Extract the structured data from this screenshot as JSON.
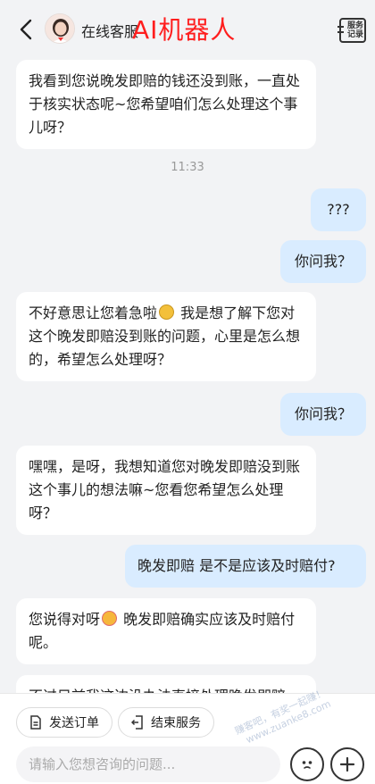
{
  "header": {
    "title": "在线客服",
    "overlay_text": "AI机器人",
    "service_record_label": "服务记录"
  },
  "messages": [
    {
      "side": "left",
      "text": "我看到您说晚发即赔的钱还没到账，一直处于核实状态呢~您希望咱们怎么处理这个事儿呀？"
    },
    {
      "side": "time",
      "text": "11:33"
    },
    {
      "side": "right",
      "text": "???"
    },
    {
      "side": "right",
      "text": "你问我？"
    },
    {
      "side": "left",
      "text_before": "不好意思让您着急啦",
      "text_after": " 我是想了解下您对这个晚发即赔没到账的问题，心里是怎么想的，希望怎么处理呀？"
    },
    {
      "side": "right",
      "text": "你问我？"
    },
    {
      "side": "left",
      "text": "嘿嘿，是呀，我想知道您对晚发即赔没到账这个事儿的想法嘛~您看您希望怎么处理呀？"
    },
    {
      "side": "right",
      "text": "晚发即赔 是不是应该及时赔付?"
    },
    {
      "side": "left",
      "text_before": "您说得对呀",
      "text_after": " 晚发即赔确实应该及时赔付呢。"
    },
    {
      "side": "left",
      "text": "不过目前我这边没办法直接处理晚发即赔"
    }
  ],
  "actions": {
    "send_order": "发送订单",
    "end_service": "结束服务"
  },
  "input": {
    "placeholder": "请输入您想咨询的问题..."
  },
  "watermark": {
    "line1": "赚客吧，有奖一起赚！",
    "line2": "www.zuanke8.com"
  },
  "colors": {
    "user_bubble": "#d9ecff",
    "agent_bubble": "#ffffff",
    "overlay_red": "#ff1e1e",
    "background": "#f2f3f5"
  }
}
